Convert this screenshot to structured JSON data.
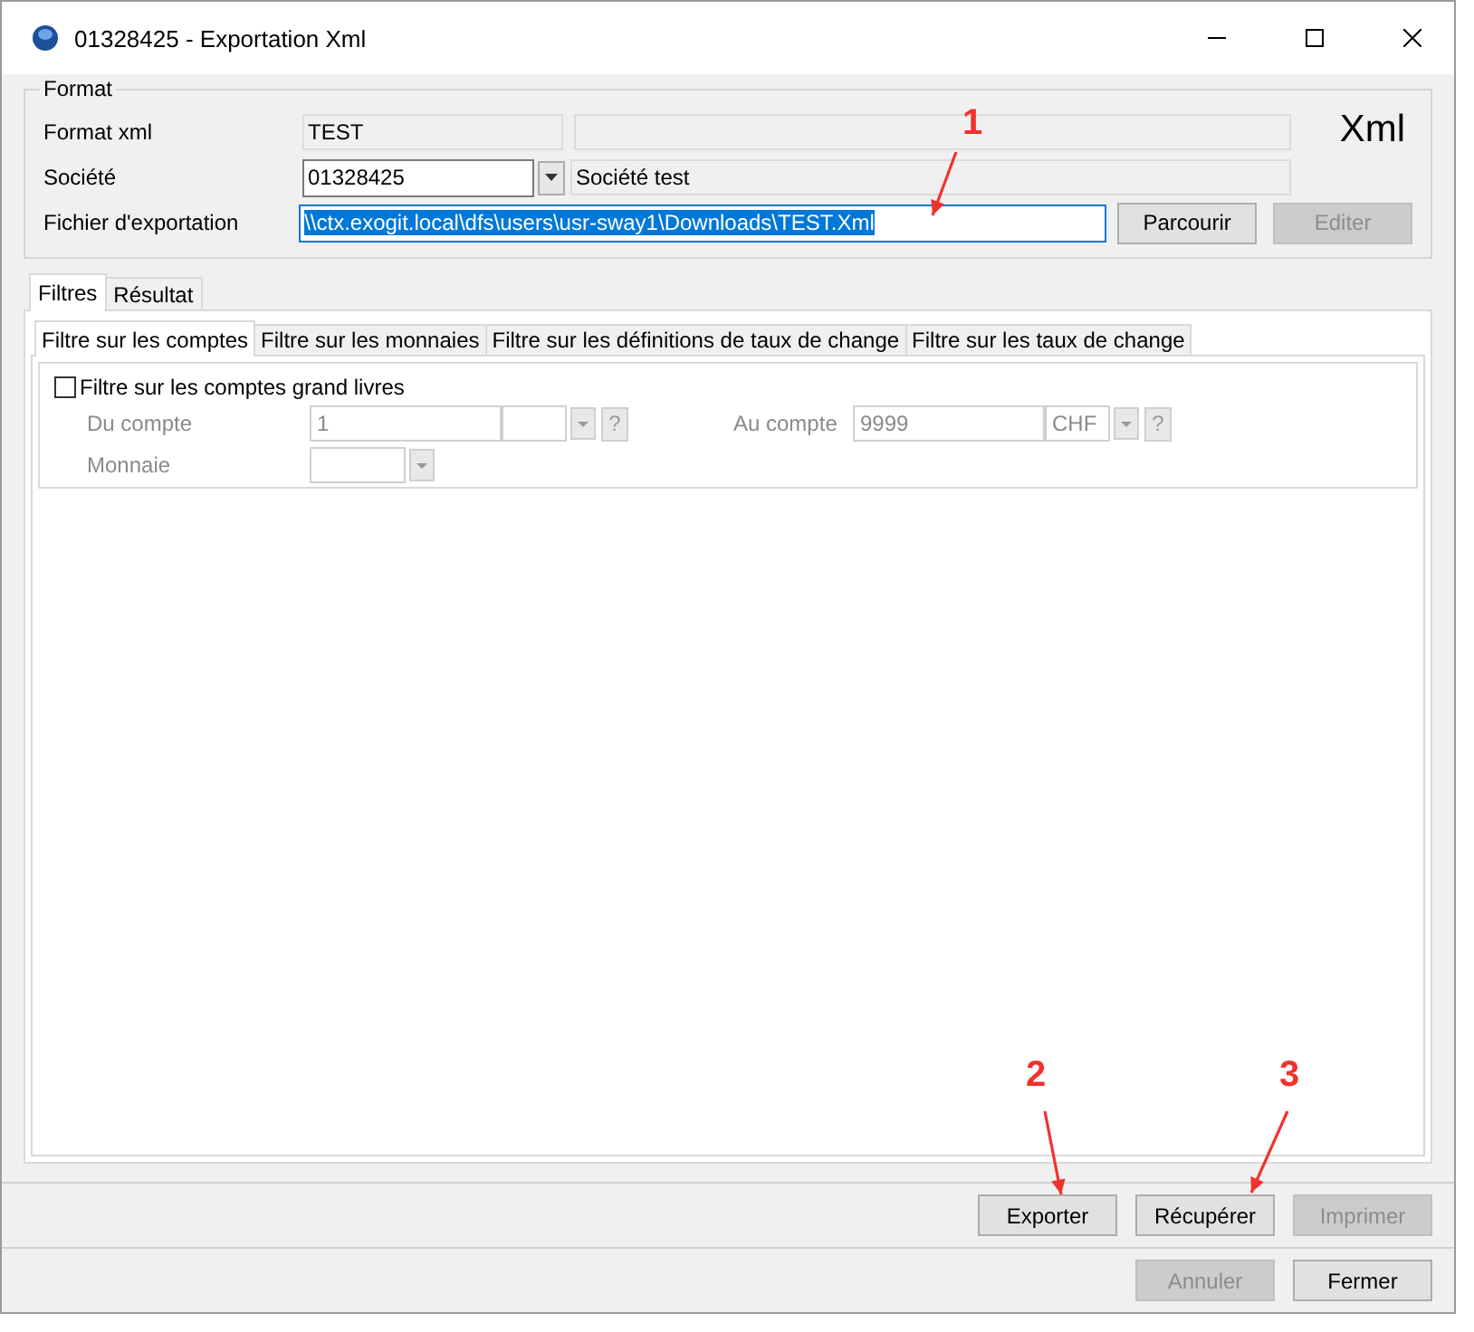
{
  "window": {
    "title": "01328425 - Exportation Xml"
  },
  "format": {
    "legend": "Format",
    "badge": "Xml",
    "rows": [
      {
        "label": "Format xml",
        "code": "TEST",
        "kind": "readonly"
      },
      {
        "label": "Société",
        "code": "01328425",
        "description": "Société test",
        "kind": "combo"
      },
      {
        "label": "Fichier d'exportation",
        "value": "\\\\ctx.exogit.local\\dfs\\users\\usr-sway1\\Downloads\\TEST.Xml",
        "kind": "file",
        "selected": true,
        "buttons": [
          {
            "label": "Parcourir",
            "disabled": false
          },
          {
            "label": "Editer",
            "disabled": true
          }
        ]
      }
    ]
  },
  "tabs": [
    {
      "label": "Filtres",
      "selected": true
    },
    {
      "label": "Résultat",
      "selected": false
    }
  ],
  "subtabs": [
    {
      "label": "Filtre sur les comptes",
      "selected": true
    },
    {
      "label": "Filtre sur les monnaies",
      "selected": false
    },
    {
      "label": "Filtre sur les définitions de taux de change",
      "selected": false
    },
    {
      "label": "Filtre sur les taux de change",
      "selected": false
    }
  ],
  "filter": {
    "label": "Filtre sur les comptes grand livres",
    "checked": false,
    "disabled": true,
    "from": {
      "label": "Du compte",
      "value": "1",
      "help": "?"
    },
    "to": {
      "label": "Au compte",
      "value": "9999",
      "currency": "CHF",
      "help": "?"
    },
    "currency": {
      "label": "Monnaie"
    }
  },
  "actions": [
    {
      "label": "Exporter",
      "disabled": false
    },
    {
      "label": "Récupérer",
      "disabled": false
    },
    {
      "label": "Imprimer",
      "disabled": true
    }
  ],
  "footer": [
    {
      "label": "Annuler",
      "disabled": true
    },
    {
      "label": "Fermer",
      "disabled": false
    }
  ],
  "annotations": [
    {
      "label": "1"
    },
    {
      "label": "2"
    },
    {
      "label": "3"
    }
  ]
}
